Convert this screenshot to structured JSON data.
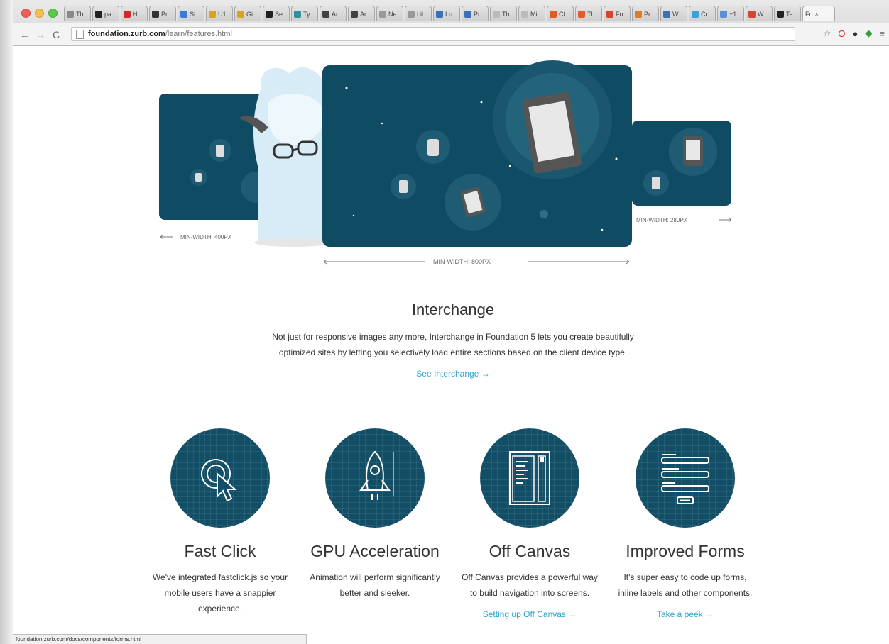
{
  "browser": {
    "tabs": [
      {
        "label": "Th",
        "color": "#888888"
      },
      {
        "label": "pa",
        "color": "#222222"
      },
      {
        "label": "Ht",
        "color": "#cc2b2b"
      },
      {
        "label": "Pr",
        "color": "#333333"
      },
      {
        "label": "St",
        "color": "#3a7bd5"
      },
      {
        "label": "U1",
        "color": "#d9a321"
      },
      {
        "label": "Gi",
        "color": "#d9a321"
      },
      {
        "label": "Se",
        "color": "#222222"
      },
      {
        "label": "Ty",
        "color": "#2f8f9d"
      },
      {
        "label": "Ar",
        "color": "#444444"
      },
      {
        "label": "Ar",
        "color": "#444444"
      },
      {
        "label": "Ne",
        "color": "#999999"
      },
      {
        "label": "Lil",
        "color": "#999999"
      },
      {
        "label": "Lo",
        "color": "#3b6fb6"
      },
      {
        "label": "Pr",
        "color": "#3b6fb6"
      },
      {
        "label": "Th",
        "color": "#bbbbbb"
      },
      {
        "label": "Mi",
        "color": "#bbbbbb"
      },
      {
        "label": "Cf",
        "color": "#e05a2a"
      },
      {
        "label": "Th",
        "color": "#e05a2a"
      },
      {
        "label": "Fo",
        "color": "#d3462f"
      },
      {
        "label": "Pr",
        "color": "#e07b2a"
      },
      {
        "label": "W",
        "color": "#3b6fb6"
      },
      {
        "label": "Cr",
        "color": "#3ba0d5"
      },
      {
        "label": "+1",
        "color": "#5b8fd5"
      },
      {
        "label": "W",
        "color": "#d3462f"
      },
      {
        "label": "Te",
        "color": "#222222"
      }
    ],
    "active_tab": {
      "label": "Fo",
      "close": "×"
    },
    "url_host": "foundation.zurb.com",
    "url_path": "/learn/features.html",
    "status_text": "foundation.zurb.com/docs/components/forms.html"
  },
  "hero": {
    "label_left": "MIN-WIDTH: 400PX",
    "label_center": "MIN-WIDTH: 800PX",
    "label_right": "MIN-WIDTH: 280PX"
  },
  "interchange": {
    "title": "Interchange",
    "body": "Not just for responsive images any more, Interchange in Foundation 5 lets you create beautifully optimized sites by letting you selectively load entire sections based on the client device type.",
    "link": "See Interchange →"
  },
  "features": [
    {
      "title": "Fast Click",
      "body": "We've integrated fastclick.js so your mobile users have a snappier experience.",
      "link": "",
      "icon": "cursor-click-icon"
    },
    {
      "title": "GPU Acceleration",
      "body": "Animation will perform significantly better and sleeker.",
      "link": "",
      "icon": "rocket-icon"
    },
    {
      "title": "Off Canvas",
      "body": "Off Canvas provides a powerful way to build navigation into screens.",
      "link": "Setting up Off Canvas →",
      "icon": "off-canvas-icon"
    },
    {
      "title": "Improved Forms",
      "body": "It's super easy to code up forms, inline labels and other components.",
      "link": "Take a peek →",
      "icon": "form-icon"
    }
  ],
  "colors": {
    "panel": "#0f4c63",
    "accent_link": "#2ba6cb",
    "icon_circle": "#124e66"
  }
}
